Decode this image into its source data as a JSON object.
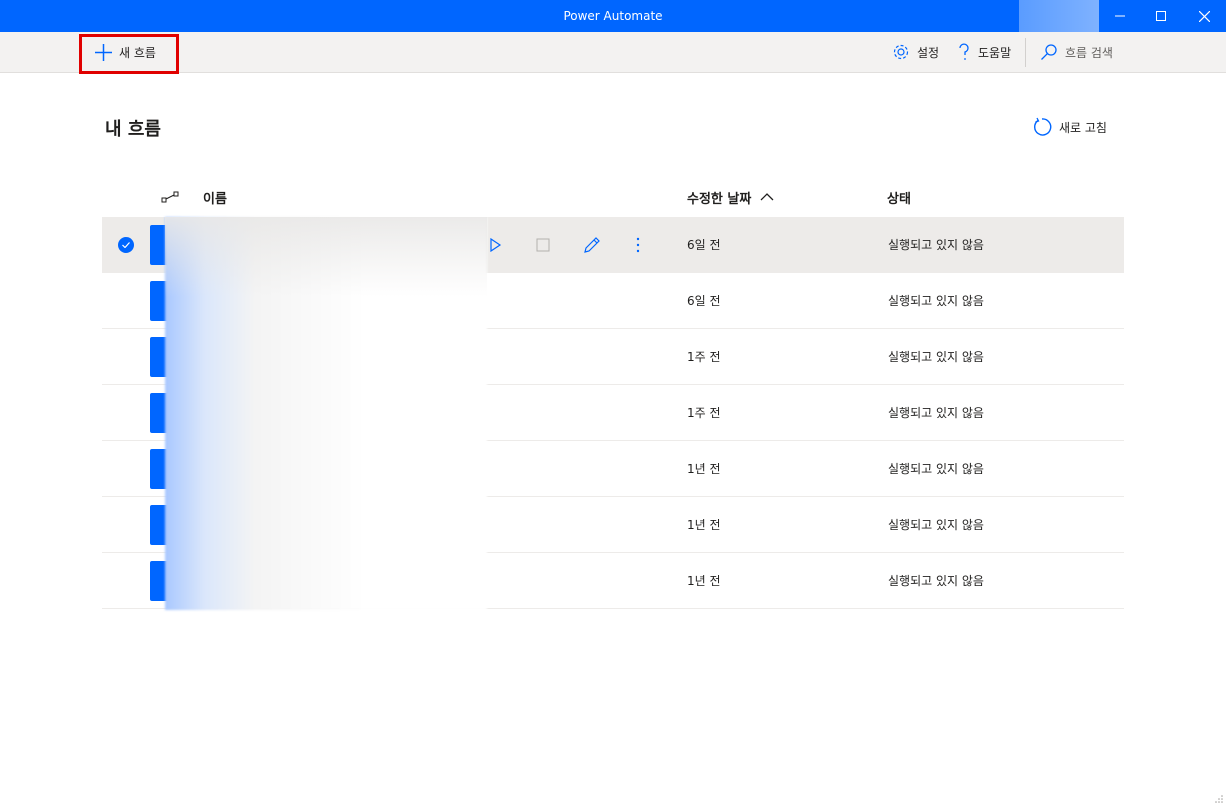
{
  "window": {
    "title": "Power Automate"
  },
  "toolbar": {
    "new_flow_label": "새 흐름",
    "settings_label": "설정",
    "help_label": "도움말",
    "search_placeholder": "흐름 검색"
  },
  "main": {
    "title": "내 흐름",
    "refresh_label": "새로 고침"
  },
  "table": {
    "columns": {
      "name": "이름",
      "modified": "수정한 날짜",
      "status": "상태"
    },
    "rows": [
      {
        "modified": "6일 전",
        "status": "실행되고 있지 않음",
        "selected": true
      },
      {
        "modified": "6일 전",
        "status": "실행되고 있지 않음",
        "selected": false
      },
      {
        "modified": "1주 전",
        "status": "실행되고 있지 않음",
        "selected": false
      },
      {
        "modified": "1주 전",
        "status": "실행되고 있지 않음",
        "selected": false
      },
      {
        "modified": "1년 전",
        "status": "실행되고 있지 않음",
        "selected": false
      },
      {
        "modified": "1년 전",
        "status": "실행되고 있지 않음",
        "selected": false
      },
      {
        "modified": "1년 전",
        "status": "실행되고 있지 않음",
        "selected": false
      }
    ]
  },
  "colors": {
    "accent": "#0066ff",
    "highlight_box": "#e00000",
    "selected_row": "#edebe9"
  }
}
